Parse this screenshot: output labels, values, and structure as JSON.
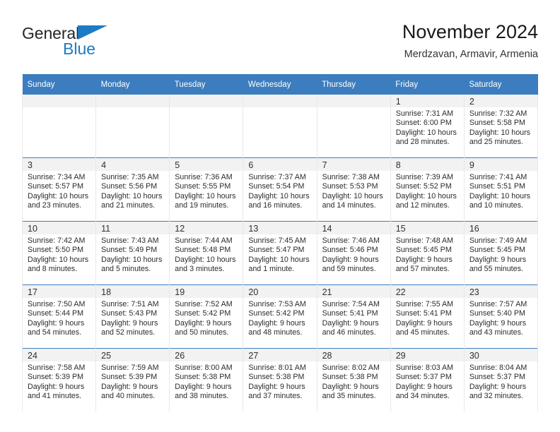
{
  "brand": {
    "name_part1": "General",
    "name_part2": "Blue",
    "accent_color": "#1c7bc4"
  },
  "header": {
    "title": "November 2024",
    "subtitle": "Merdzavan, Armavir, Armenia"
  },
  "calendar": {
    "header_bg": "#3b7dbf",
    "daynum_bg": "#f2f2f2",
    "weekdays": [
      "Sunday",
      "Monday",
      "Tuesday",
      "Wednesday",
      "Thursday",
      "Friday",
      "Saturday"
    ],
    "weeks": [
      [
        {
          "day": "",
          "lines": []
        },
        {
          "day": "",
          "lines": []
        },
        {
          "day": "",
          "lines": []
        },
        {
          "day": "",
          "lines": []
        },
        {
          "day": "",
          "lines": []
        },
        {
          "day": "1",
          "lines": [
            "Sunrise: 7:31 AM",
            "Sunset: 6:00 PM",
            "Daylight: 10 hours",
            "and 28 minutes."
          ]
        },
        {
          "day": "2",
          "lines": [
            "Sunrise: 7:32 AM",
            "Sunset: 5:58 PM",
            "Daylight: 10 hours",
            "and 25 minutes."
          ]
        }
      ],
      [
        {
          "day": "3",
          "lines": [
            "Sunrise: 7:34 AM",
            "Sunset: 5:57 PM",
            "Daylight: 10 hours",
            "and 23 minutes."
          ]
        },
        {
          "day": "4",
          "lines": [
            "Sunrise: 7:35 AM",
            "Sunset: 5:56 PM",
            "Daylight: 10 hours",
            "and 21 minutes."
          ]
        },
        {
          "day": "5",
          "lines": [
            "Sunrise: 7:36 AM",
            "Sunset: 5:55 PM",
            "Daylight: 10 hours",
            "and 19 minutes."
          ]
        },
        {
          "day": "6",
          "lines": [
            "Sunrise: 7:37 AM",
            "Sunset: 5:54 PM",
            "Daylight: 10 hours",
            "and 16 minutes."
          ]
        },
        {
          "day": "7",
          "lines": [
            "Sunrise: 7:38 AM",
            "Sunset: 5:53 PM",
            "Daylight: 10 hours",
            "and 14 minutes."
          ]
        },
        {
          "day": "8",
          "lines": [
            "Sunrise: 7:39 AM",
            "Sunset: 5:52 PM",
            "Daylight: 10 hours",
            "and 12 minutes."
          ]
        },
        {
          "day": "9",
          "lines": [
            "Sunrise: 7:41 AM",
            "Sunset: 5:51 PM",
            "Daylight: 10 hours",
            "and 10 minutes."
          ]
        }
      ],
      [
        {
          "day": "10",
          "lines": [
            "Sunrise: 7:42 AM",
            "Sunset: 5:50 PM",
            "Daylight: 10 hours",
            "and 8 minutes."
          ]
        },
        {
          "day": "11",
          "lines": [
            "Sunrise: 7:43 AM",
            "Sunset: 5:49 PM",
            "Daylight: 10 hours",
            "and 5 minutes."
          ]
        },
        {
          "day": "12",
          "lines": [
            "Sunrise: 7:44 AM",
            "Sunset: 5:48 PM",
            "Daylight: 10 hours",
            "and 3 minutes."
          ]
        },
        {
          "day": "13",
          "lines": [
            "Sunrise: 7:45 AM",
            "Sunset: 5:47 PM",
            "Daylight: 10 hours",
            "and 1 minute."
          ]
        },
        {
          "day": "14",
          "lines": [
            "Sunrise: 7:46 AM",
            "Sunset: 5:46 PM",
            "Daylight: 9 hours",
            "and 59 minutes."
          ]
        },
        {
          "day": "15",
          "lines": [
            "Sunrise: 7:48 AM",
            "Sunset: 5:45 PM",
            "Daylight: 9 hours",
            "and 57 minutes."
          ]
        },
        {
          "day": "16",
          "lines": [
            "Sunrise: 7:49 AM",
            "Sunset: 5:45 PM",
            "Daylight: 9 hours",
            "and 55 minutes."
          ]
        }
      ],
      [
        {
          "day": "17",
          "lines": [
            "Sunrise: 7:50 AM",
            "Sunset: 5:44 PM",
            "Daylight: 9 hours",
            "and 54 minutes."
          ]
        },
        {
          "day": "18",
          "lines": [
            "Sunrise: 7:51 AM",
            "Sunset: 5:43 PM",
            "Daylight: 9 hours",
            "and 52 minutes."
          ]
        },
        {
          "day": "19",
          "lines": [
            "Sunrise: 7:52 AM",
            "Sunset: 5:42 PM",
            "Daylight: 9 hours",
            "and 50 minutes."
          ]
        },
        {
          "day": "20",
          "lines": [
            "Sunrise: 7:53 AM",
            "Sunset: 5:42 PM",
            "Daylight: 9 hours",
            "and 48 minutes."
          ]
        },
        {
          "day": "21",
          "lines": [
            "Sunrise: 7:54 AM",
            "Sunset: 5:41 PM",
            "Daylight: 9 hours",
            "and 46 minutes."
          ]
        },
        {
          "day": "22",
          "lines": [
            "Sunrise: 7:55 AM",
            "Sunset: 5:41 PM",
            "Daylight: 9 hours",
            "and 45 minutes."
          ]
        },
        {
          "day": "23",
          "lines": [
            "Sunrise: 7:57 AM",
            "Sunset: 5:40 PM",
            "Daylight: 9 hours",
            "and 43 minutes."
          ]
        }
      ],
      [
        {
          "day": "24",
          "lines": [
            "Sunrise: 7:58 AM",
            "Sunset: 5:39 PM",
            "Daylight: 9 hours",
            "and 41 minutes."
          ]
        },
        {
          "day": "25",
          "lines": [
            "Sunrise: 7:59 AM",
            "Sunset: 5:39 PM",
            "Daylight: 9 hours",
            "and 40 minutes."
          ]
        },
        {
          "day": "26",
          "lines": [
            "Sunrise: 8:00 AM",
            "Sunset: 5:38 PM",
            "Daylight: 9 hours",
            "and 38 minutes."
          ]
        },
        {
          "day": "27",
          "lines": [
            "Sunrise: 8:01 AM",
            "Sunset: 5:38 PM",
            "Daylight: 9 hours",
            "and 37 minutes."
          ]
        },
        {
          "day": "28",
          "lines": [
            "Sunrise: 8:02 AM",
            "Sunset: 5:38 PM",
            "Daylight: 9 hours",
            "and 35 minutes."
          ]
        },
        {
          "day": "29",
          "lines": [
            "Sunrise: 8:03 AM",
            "Sunset: 5:37 PM",
            "Daylight: 9 hours",
            "and 34 minutes."
          ]
        },
        {
          "day": "30",
          "lines": [
            "Sunrise: 8:04 AM",
            "Sunset: 5:37 PM",
            "Daylight: 9 hours",
            "and 32 minutes."
          ]
        }
      ]
    ]
  }
}
